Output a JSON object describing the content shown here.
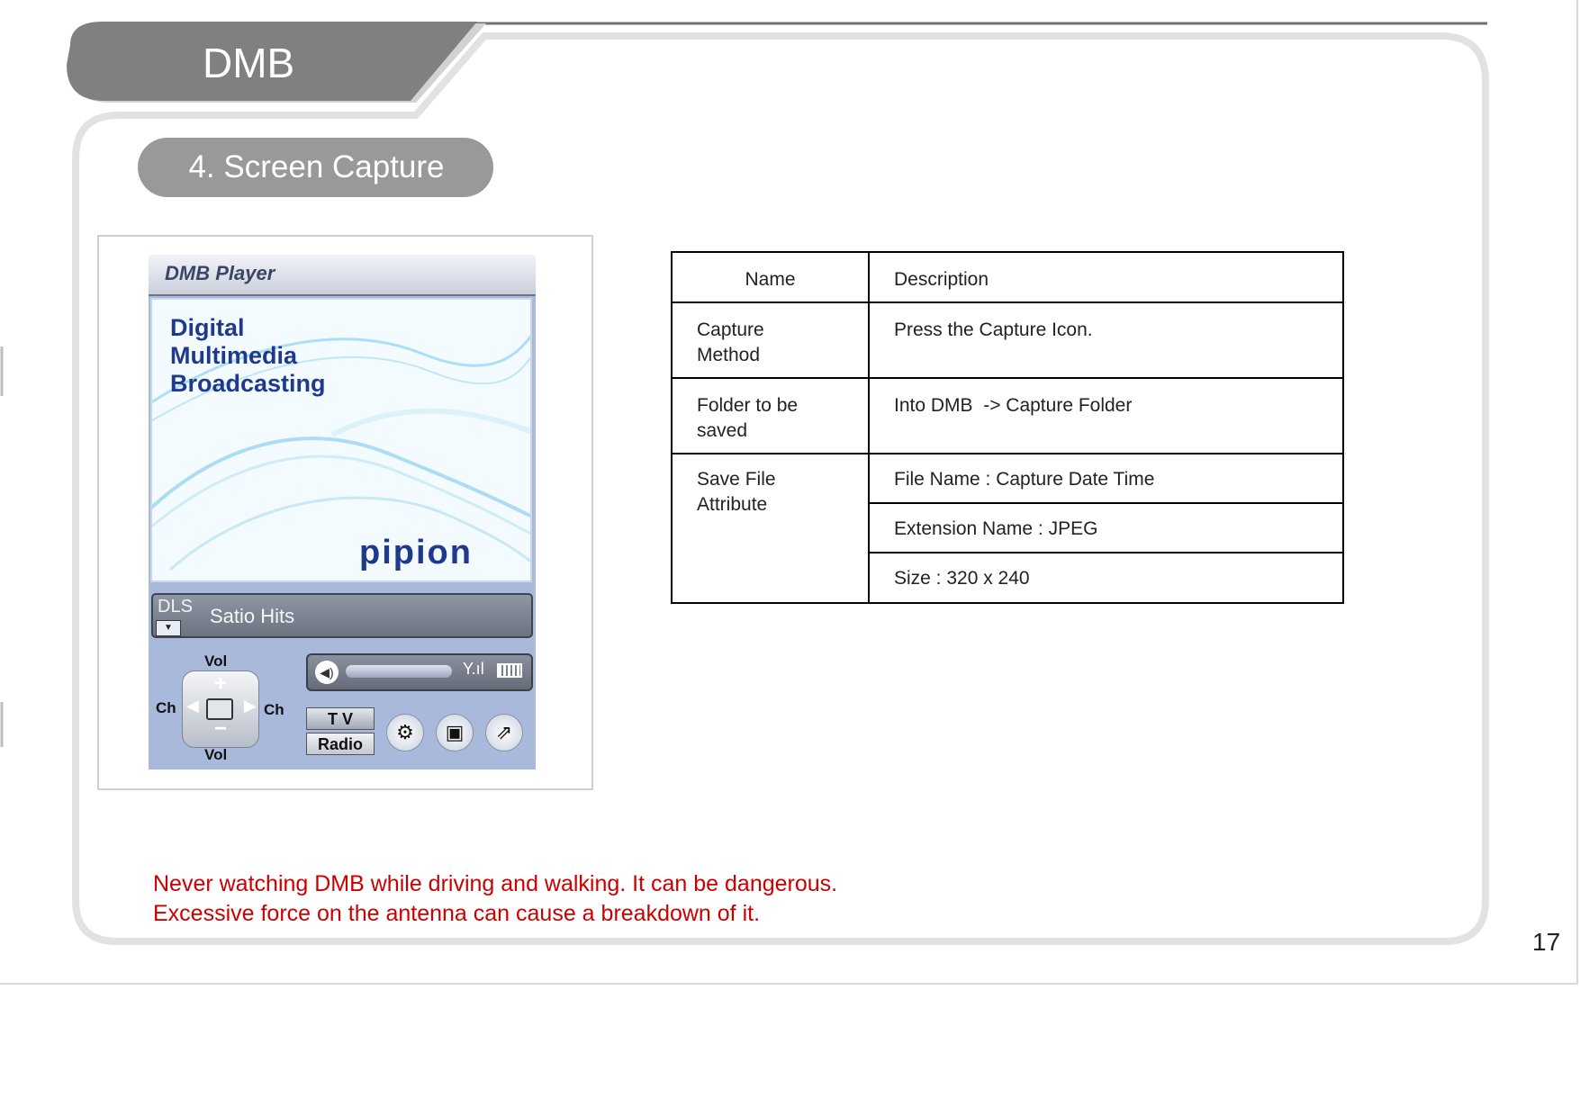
{
  "header": {
    "section_title": "DMB",
    "subsection_title": "4. Screen Capture"
  },
  "device_screen": {
    "window_title": "DMB Player",
    "headline_lines": [
      "Digital",
      "Multimedia",
      "Broadcasting"
    ],
    "brand_logo": "pipion",
    "dls_tag": "DLS",
    "dls_text": "Satio Hits",
    "vol_label_top": "Vol",
    "vol_label_bottom": "Vol",
    "ch_label_left": "Ch",
    "ch_label_right": "Ch",
    "tv_button": "T V",
    "radio_button": "Radio",
    "icons": [
      "speaker-icon",
      "signal-icon",
      "battery-icon",
      "settings-gear-icon",
      "capture-camera-icon",
      "expand-icon"
    ]
  },
  "table": {
    "header_name": "Name",
    "header_description": "Description",
    "rows": [
      {
        "name": "Capture Method",
        "description": "Press the Capture Icon."
      },
      {
        "name": "Folder to be saved",
        "description": "Into DMB  -> Capture Folder"
      },
      {
        "name": "Save File Attribute",
        "descriptions": [
          "File Name : Capture Date Time",
          "Extension Name : JPEG",
          "Size : 320 x 240"
        ]
      }
    ]
  },
  "warnings": [
    "Never watching DMB while driving and walking. It can be dangerous.",
    "Excessive force on the antenna can cause a breakdown of it."
  ],
  "page_number": "17",
  "colors": {
    "warning_text": "#cc0000",
    "header_tab": "#808080",
    "pill": "#999999"
  }
}
